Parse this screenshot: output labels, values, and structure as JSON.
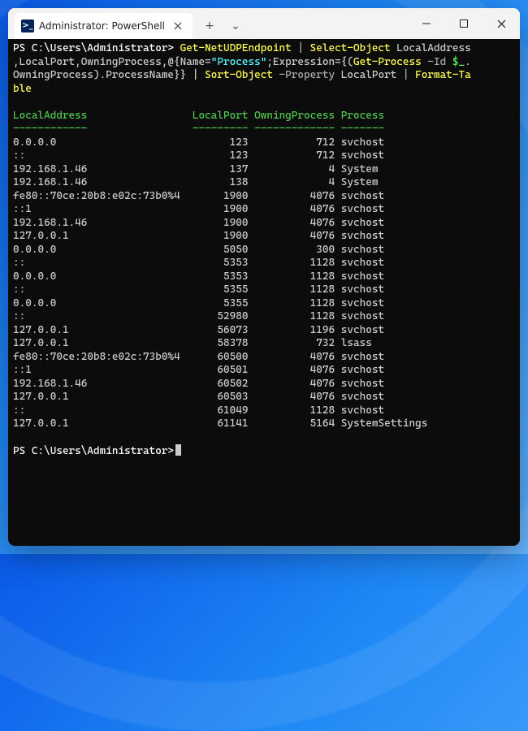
{
  "window": {
    "tab_title": "Administrator: PowerShell",
    "icon_glyph": ">_",
    "newtab_glyph": "+",
    "dropdown_glyph": "⌄"
  },
  "terminal": {
    "prompt1": "PS C:\\Users\\Administrator> ",
    "prompt2": "PS C:\\Users\\Administrator>",
    "command": {
      "cmd1": "Get-NetUDPEndpoint",
      "pipe": " | ",
      "cmd2": "Select-Object",
      "args2a": " LocalAddress",
      "args2b": ",LocalPort,OwningProcess,@{Name=",
      "string1": "\"Process\"",
      "args2c": ";Expression={(",
      "cmd3": "Get-Process",
      "flag1": " -Id ",
      "var1": "$_",
      "args2d": ".",
      "args2e": "OwningProcess).ProcessName}} | ",
      "cmd4": "Sort-Object",
      "flag2": " -Property ",
      "args4": "LocalPort ",
      "pipe2": "| ",
      "cmd5": "Format-Ta",
      "cmd5b": "ble"
    },
    "headers": [
      "LocalAddress",
      "LocalPort",
      "OwningProcess",
      "Process"
    ],
    "underlines": [
      "------------",
      "---------",
      "-------------",
      "-------"
    ],
    "rows": [
      {
        "addr": "0.0.0.0",
        "port": "123",
        "own": "712",
        "proc": "svchost"
      },
      {
        "addr": "::",
        "port": "123",
        "own": "712",
        "proc": "svchost"
      },
      {
        "addr": "192.168.1.46",
        "port": "137",
        "own": "4",
        "proc": "System"
      },
      {
        "addr": "192.168.1.46",
        "port": "138",
        "own": "4",
        "proc": "System"
      },
      {
        "addr": "fe80::70ce:20b8:e02c:73b0%4",
        "port": "1900",
        "own": "4076",
        "proc": "svchost"
      },
      {
        "addr": "::1",
        "port": "1900",
        "own": "4076",
        "proc": "svchost"
      },
      {
        "addr": "192.168.1.46",
        "port": "1900",
        "own": "4076",
        "proc": "svchost"
      },
      {
        "addr": "127.0.0.1",
        "port": "1900",
        "own": "4076",
        "proc": "svchost"
      },
      {
        "addr": "0.0.0.0",
        "port": "5050",
        "own": "300",
        "proc": "svchost"
      },
      {
        "addr": "::",
        "port": "5353",
        "own": "1128",
        "proc": "svchost"
      },
      {
        "addr": "0.0.0.0",
        "port": "5353",
        "own": "1128",
        "proc": "svchost"
      },
      {
        "addr": "::",
        "port": "5355",
        "own": "1128",
        "proc": "svchost"
      },
      {
        "addr": "0.0.0.0",
        "port": "5355",
        "own": "1128",
        "proc": "svchost"
      },
      {
        "addr": "::",
        "port": "52980",
        "own": "1128",
        "proc": "svchost"
      },
      {
        "addr": "127.0.0.1",
        "port": "56073",
        "own": "1196",
        "proc": "svchost"
      },
      {
        "addr": "127.0.0.1",
        "port": "58378",
        "own": "732",
        "proc": "lsass"
      },
      {
        "addr": "fe80::70ce:20b8:e02c:73b0%4",
        "port": "60500",
        "own": "4076",
        "proc": "svchost"
      },
      {
        "addr": "::1",
        "port": "60501",
        "own": "4076",
        "proc": "svchost"
      },
      {
        "addr": "192.168.1.46",
        "port": "60502",
        "own": "4076",
        "proc": "svchost"
      },
      {
        "addr": "127.0.0.1",
        "port": "60503",
        "own": "4076",
        "proc": "svchost"
      },
      {
        "addr": "::",
        "port": "61049",
        "own": "1128",
        "proc": "svchost"
      },
      {
        "addr": "127.0.0.1",
        "port": "61141",
        "own": "5164",
        "proc": "SystemSettings"
      }
    ],
    "column_widths": {
      "addr": 29,
      "port": 13,
      "own": 14
    }
  }
}
